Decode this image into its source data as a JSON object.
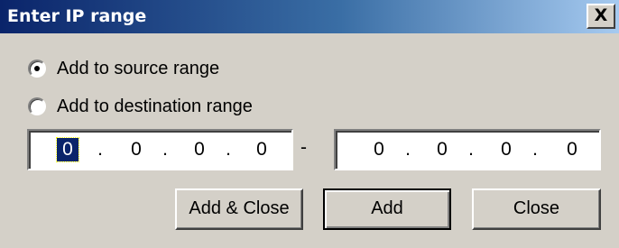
{
  "window": {
    "title": "Enter IP range",
    "close_glyph": "X"
  },
  "options": {
    "source_label": "Add to source range",
    "destination_label": "Add to destination range",
    "selected": "source"
  },
  "range": {
    "start": [
      "0",
      "0",
      "0",
      "0"
    ],
    "separator": "-",
    "end": [
      "0",
      "0",
      "0",
      "0"
    ],
    "octet_separator": "."
  },
  "buttons": {
    "add_close": "Add & Close",
    "add": "Add",
    "close": "Close"
  },
  "colors": {
    "face": "#d4d0c8",
    "titlebar_start": "#0a246a",
    "titlebar_end": "#a6caf0",
    "selection": "#0a246a"
  },
  "icons": {
    "close": "close-icon",
    "radio": "radio-button"
  }
}
